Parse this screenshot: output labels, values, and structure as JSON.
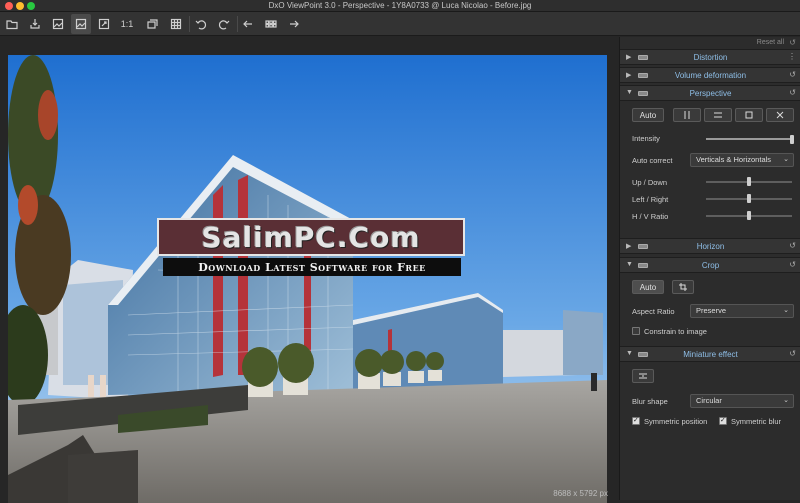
{
  "window": {
    "title": "DxO ViewPoint 3.0 - Perspective - 1Y8A0733 @ Luca Nicolao - Before.jpg"
  },
  "toolbar": {
    "items": [
      {
        "name": "open-folder-icon"
      },
      {
        "name": "export-icon"
      },
      {
        "name": "image-before-icon"
      },
      {
        "name": "image-after-icon"
      },
      {
        "name": "fit-to-screen-icon"
      },
      {
        "name": "zoom-100",
        "label": "1:1"
      },
      {
        "name": "compare-icon"
      },
      {
        "name": "grid-icon"
      },
      {
        "name": "rotate-left-icon"
      },
      {
        "name": "rotate-right-icon"
      },
      {
        "name": "previous-icon"
      },
      {
        "name": "filmstrip-icon"
      },
      {
        "name": "next-icon"
      }
    ]
  },
  "viewer": {
    "image_size": "8688 x 5792 px"
  },
  "watermark": {
    "title": "SalimPC.Com",
    "subtitle": "Download Latest Software for Free"
  },
  "panel": {
    "reset_all": "Reset all",
    "sections": {
      "distortion": "Distortion",
      "volume": "Volume deformation",
      "perspective": "Perspective",
      "horizon": "Horizon",
      "crop": "Crop",
      "miniature": "Miniature effect"
    },
    "perspective": {
      "auto_button": "Auto",
      "intensity_label": "Intensity",
      "intensity_value": 1.0,
      "auto_correct_label": "Auto correct",
      "auto_correct_value": "Verticals & Horizontals",
      "up_down_label": "Up / Down",
      "up_down_value": 0.5,
      "left_right_label": "Left / Right",
      "left_right_value": 0.5,
      "hv_ratio_label": "H / V Ratio",
      "hv_ratio_value": 0.5
    },
    "crop": {
      "auto_button": "Auto",
      "aspect_label": "Aspect Ratio",
      "aspect_value": "Preserve",
      "constrain_label": "Constrain to image",
      "constrain_checked": false
    },
    "miniature": {
      "blur_shape_label": "Blur shape",
      "blur_shape_value": "Circular",
      "symmetric_position_label": "Symmetric position",
      "symmetric_position_checked": true,
      "symmetric_blur_label": "Symmetric blur",
      "symmetric_blur_checked": true
    }
  }
}
